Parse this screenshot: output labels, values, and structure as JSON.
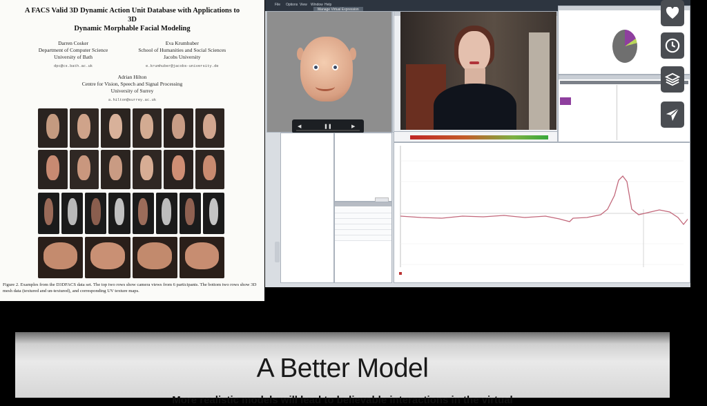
{
  "paper": {
    "title_line1": "A FACS Valid 3D Dynamic Action Unit Database with Applications to 3D",
    "title_line2": "Dynamic Morphable Facial Modeling",
    "author1": {
      "name": "Darren Cosker",
      "line1": "Department of Computer Science",
      "line2": "University of Bath",
      "email": "dpc@cs.bath.ac.uk"
    },
    "author2": {
      "name": "Eva Krumhuber",
      "line1": "School of Humanities and Social Sciences",
      "line2": "Jacobs University",
      "email": "e.krumhuber@jacobs-university.de"
    },
    "author3": {
      "name": "Adrian Hilton",
      "line1": "Centre for Vision, Speech and Signal Processing",
      "line2": "University of Surrey",
      "email": "a.hilton@surrey.ac.uk"
    },
    "caption": "Figure 2. Examples from the D3DFACS data set. The top two rows show camera views from 6 participants. The bottom two rows show 3D mesh data (textured and un-textured), and corresponding UV texture maps."
  },
  "app": {
    "menu": [
      "File",
      "Options",
      "View",
      "Window",
      "Help"
    ],
    "window_title": "Manage Virtual Expression"
  },
  "slide": {
    "title": "A Better Model",
    "subtitle": "More realistic models will lead to believable interactions in the virtual"
  },
  "side_buttons": [
    "heart-icon",
    "clock-icon",
    "layers-icon",
    "send-icon"
  ],
  "colors": {
    "accent_purple": "#8e3f9e",
    "signal_line": "#c2677a",
    "button_bg": "#4a4d52"
  }
}
